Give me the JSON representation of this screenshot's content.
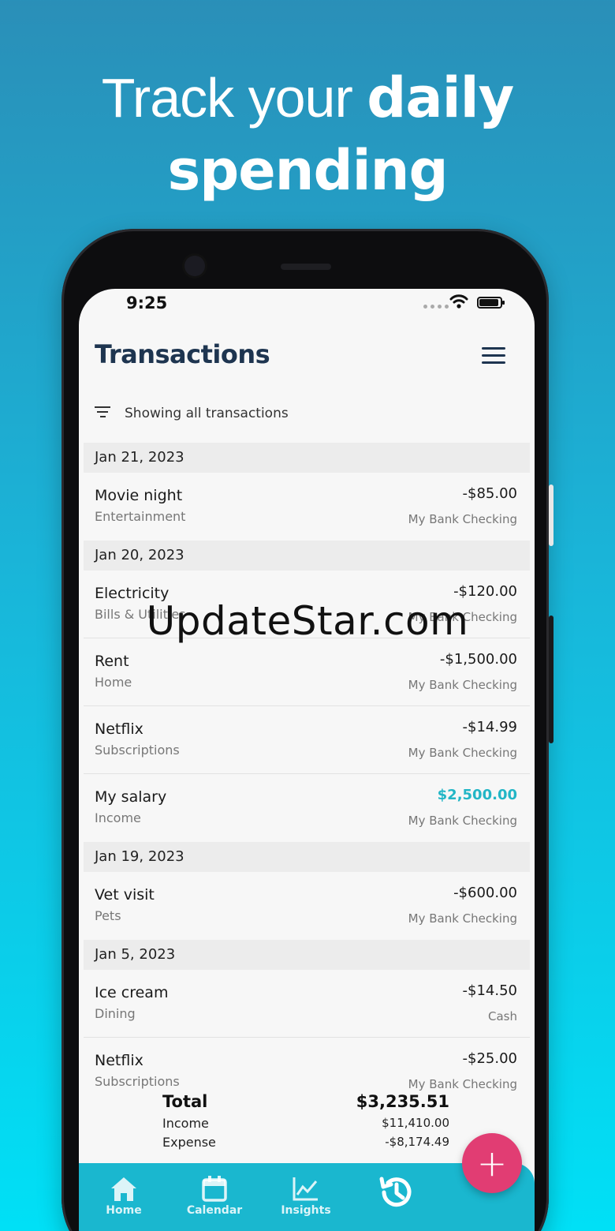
{
  "headline": {
    "light": "Track your ",
    "bold1": "daily",
    "bold2": "spending"
  },
  "status": {
    "time": "9:25"
  },
  "header": {
    "title": "Transactions"
  },
  "filter": {
    "label": "Showing all transactions"
  },
  "groups": [
    {
      "date": "Jan 21, 2023",
      "items": [
        {
          "name": "Movie night",
          "category": "Entertainment",
          "amount": "-$85.00",
          "account": "My Bank Checking",
          "income": false
        }
      ]
    },
    {
      "date": "Jan 20, 2023",
      "items": [
        {
          "name": "Electricity",
          "category": "Bills & Utilities",
          "amount": "-$120.00",
          "account": "My Bank Checking",
          "income": false
        },
        {
          "name": "Rent",
          "category": "Home",
          "amount": "-$1,500.00",
          "account": "My Bank Checking",
          "income": false
        },
        {
          "name": "Netflix",
          "category": "Subscriptions",
          "amount": "-$14.99",
          "account": "My Bank Checking",
          "income": false
        },
        {
          "name": "My salary",
          "category": "Income",
          "amount": "$2,500.00",
          "account": "My Bank Checking",
          "income": true
        }
      ]
    },
    {
      "date": "Jan 19, 2023",
      "items": [
        {
          "name": "Vet visit",
          "category": "Pets",
          "amount": "-$600.00",
          "account": "My Bank Checking",
          "income": false
        }
      ]
    },
    {
      "date": "Jan 5, 2023",
      "items": [
        {
          "name": "Ice cream",
          "category": "Dining",
          "amount": "-$14.50",
          "account": "Cash",
          "income": false
        },
        {
          "name": "Netflix",
          "category": "Subscriptions",
          "amount": "-$25.00",
          "account": "My Bank Checking",
          "income": false
        }
      ]
    }
  ],
  "totals": {
    "total_label": "Total",
    "total_value": "$3,235.51",
    "income_label": "Income",
    "income_value": "$11,410.00",
    "expense_label": "Expense",
    "expense_value": "-$8,174.49"
  },
  "tabs": [
    {
      "label": "Home",
      "icon": "home-icon"
    },
    {
      "label": "Calendar",
      "icon": "calendar-icon"
    },
    {
      "label": "Insights",
      "icon": "chart-icon"
    },
    {
      "label": "",
      "icon": "history-icon"
    }
  ],
  "fab": {
    "label": "+"
  },
  "watermark": "UpdateStar.com",
  "colors": {
    "accent": "#1ab7cf",
    "income": "#22b6c6",
    "fab": "#e13d73",
    "title": "#1e3550"
  }
}
